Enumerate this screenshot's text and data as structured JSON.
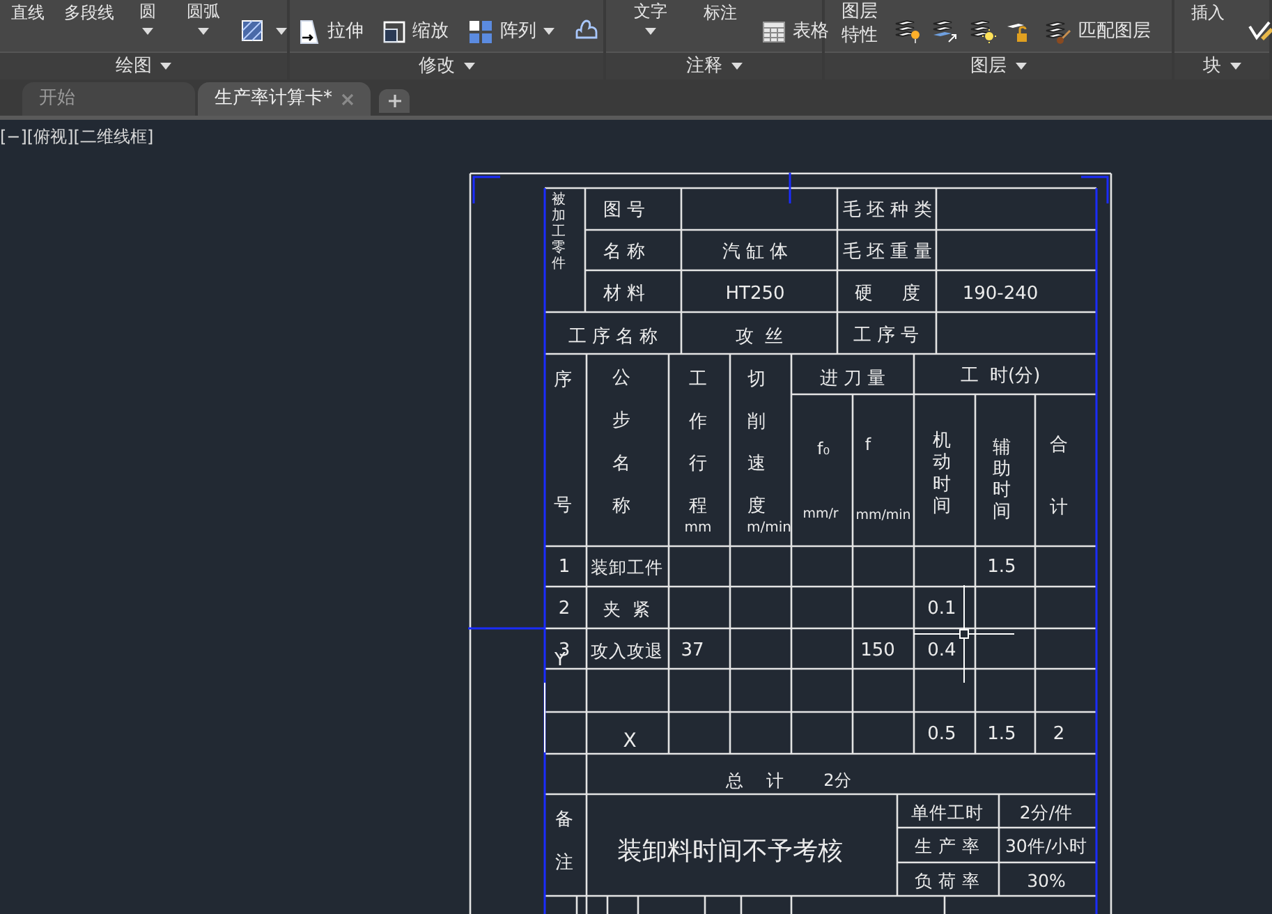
{
  "ribbon": {
    "panels": [
      {
        "label": "绘图",
        "tools": [
          {
            "kind": "label",
            "label": "直线"
          },
          {
            "kind": "label",
            "label": "多段线"
          },
          {
            "kind": "label_caret",
            "label": "圆"
          },
          {
            "kind": "label_caret",
            "label": "圆弧"
          },
          {
            "kind": "icon_caret"
          }
        ]
      },
      {
        "label": "修改",
        "tools": [
          {
            "kind": "icon_label",
            "label": "拉伸"
          },
          {
            "kind": "icon_label",
            "label": "缩放"
          },
          {
            "kind": "icon_label_caret",
            "label": "阵列"
          },
          {
            "kind": "icon"
          }
        ]
      },
      {
        "label": "注释",
        "tools": [
          {
            "kind": "label_caret",
            "label": "文字"
          },
          {
            "kind": "label",
            "label": "标注"
          },
          {
            "kind": "icon_label",
            "label": "表格"
          }
        ]
      },
      {
        "label": "图层",
        "tools": [
          {
            "kind": "two_line",
            "lines": [
              "图层",
              "特性"
            ]
          },
          {
            "kind": "icon"
          },
          {
            "kind": "icon"
          },
          {
            "kind": "icon"
          },
          {
            "kind": "icon"
          },
          {
            "kind": "icon_label",
            "label": "匹配图层"
          }
        ]
      },
      {
        "label": "块",
        "tools": [
          {
            "kind": "label",
            "label": "插入"
          },
          {
            "kind": "icon"
          }
        ]
      }
    ]
  },
  "tabs": [
    {
      "label": "开始",
      "selected": false,
      "closable": false
    },
    {
      "label": "生产率计算卡*",
      "selected": true,
      "closable": true
    }
  ],
  "viewport_controls": [
    "[−]",
    "[俯视]",
    "[二维线框]"
  ],
  "drawing": {
    "part_label": "被加工零件",
    "info_left": [
      {
        "label": "图 号"
      },
      {
        "label": "名 称",
        "value": "汽 缸 体"
      },
      {
        "label": "材 料",
        "value": "HT250"
      }
    ],
    "info_right": [
      {
        "label": "毛 坯 种 类"
      },
      {
        "label": "毛 坯 重 量"
      },
      {
        "label": "硬     度",
        "value": "190-240"
      }
    ],
    "process": {
      "name_label": "工 序 名 称",
      "name": "攻  丝",
      "number_label": "工 序 号"
    },
    "columns": [
      {
        "lines": [
          "序",
          "号"
        ]
      },
      {
        "label": "公步名称"
      },
      {
        "label": "工作行程",
        "unit": "mm"
      },
      {
        "label": "切削速度",
        "unit": "m/min"
      }
    ],
    "feed": {
      "title": "进 刀 量",
      "columns": [
        {
          "symbol": "f₀",
          "unit": "mm/r"
        },
        {
          "symbol": "f",
          "unit": "mm/min"
        }
      ]
    },
    "time": {
      "title": "工  时(分)",
      "columns": [
        {
          "label": "机动时间"
        },
        {
          "label": "辅助时间"
        },
        {
          "label": "合计"
        }
      ]
    },
    "rows": [
      {
        "no": "1",
        "step": "装卸工件",
        "aux_time": "1.5"
      },
      {
        "no": "2",
        "step": "夹  紧",
        "machine_time": "0.1"
      },
      {
        "no": "3",
        "step": "攻入攻退",
        "stroke": "37",
        "feed_per_min": "150",
        "machine_time": "0.4"
      },
      {},
      {
        "machine_time": "0.5",
        "aux_time": "1.5",
        "total": "2"
      }
    ],
    "total": {
      "label": "总    计",
      "value": "2分"
    },
    "remarks": {
      "label": "备注",
      "text": "装卸料时间不予考核"
    },
    "summary": [
      {
        "label": "单件工时",
        "value": "2分/件"
      },
      {
        "label": "生 产 率",
        "value": "30件/小时"
      },
      {
        "label": "负 荷 率",
        "value": "30%"
      }
    ],
    "ucs": {
      "x": "X",
      "y": "Y"
    }
  }
}
